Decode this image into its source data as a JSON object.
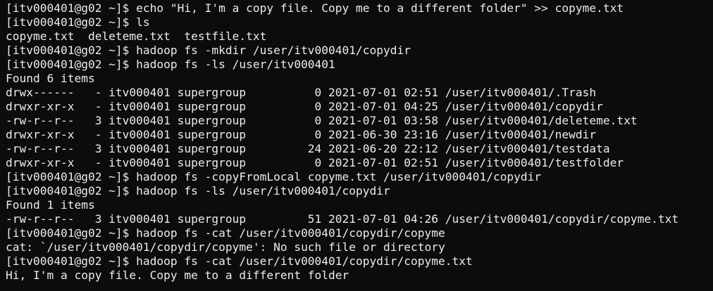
{
  "terminal": {
    "lines": [
      "[itv000401@g02 ~]$ echo \"Hi, I'm a copy file. Copy me to a different folder\" >> copyme.txt",
      "[itv000401@g02 ~]$ ls",
      "copyme.txt  deleteme.txt  testfile.txt",
      "[itv000401@g02 ~]$ hadoop fs -mkdir /user/itv000401/copydir",
      "[itv000401@g02 ~]$ hadoop fs -ls /user/itv000401",
      "Found 6 items",
      "drwx------   - itv000401 supergroup          0 2021-07-01 02:51 /user/itv000401/.Trash",
      "drwxr-xr-x   - itv000401 supergroup          0 2021-07-01 04:25 /user/itv000401/copydir",
      "-rw-r--r--   3 itv000401 supergroup          0 2021-07-01 03:58 /user/itv000401/deleteme.txt",
      "drwxr-xr-x   - itv000401 supergroup          0 2021-06-30 23:16 /user/itv000401/newdir",
      "-rw-r--r--   3 itv000401 supergroup         24 2021-06-20 22:12 /user/itv000401/testdata",
      "drwxr-xr-x   - itv000401 supergroup          0 2021-07-01 02:51 /user/itv000401/testfolder",
      "[itv000401@g02 ~]$ hadoop fs -copyFromLocal copyme.txt /user/itv000401/copydir",
      "[itv000401@g02 ~]$ hadoop fs -ls /user/itv000401/copydir",
      "Found 1 items",
      "-rw-r--r--   3 itv000401 supergroup         51 2021-07-01 04:26 /user/itv000401/copydir/copyme.txt",
      "[itv000401@g02 ~]$ hadoop fs -cat /user/itv000401/copydir/copyme",
      "cat: `/user/itv000401/copydir/copyme': No such file or directory",
      "[itv000401@g02 ~]$ hadoop fs -cat /user/itv000401/copydir/copyme.txt",
      "Hi, I'm a copy file. Copy me to a different folder"
    ]
  },
  "colors": {
    "background": "#0c0c0c",
    "text": "#ececec"
  }
}
